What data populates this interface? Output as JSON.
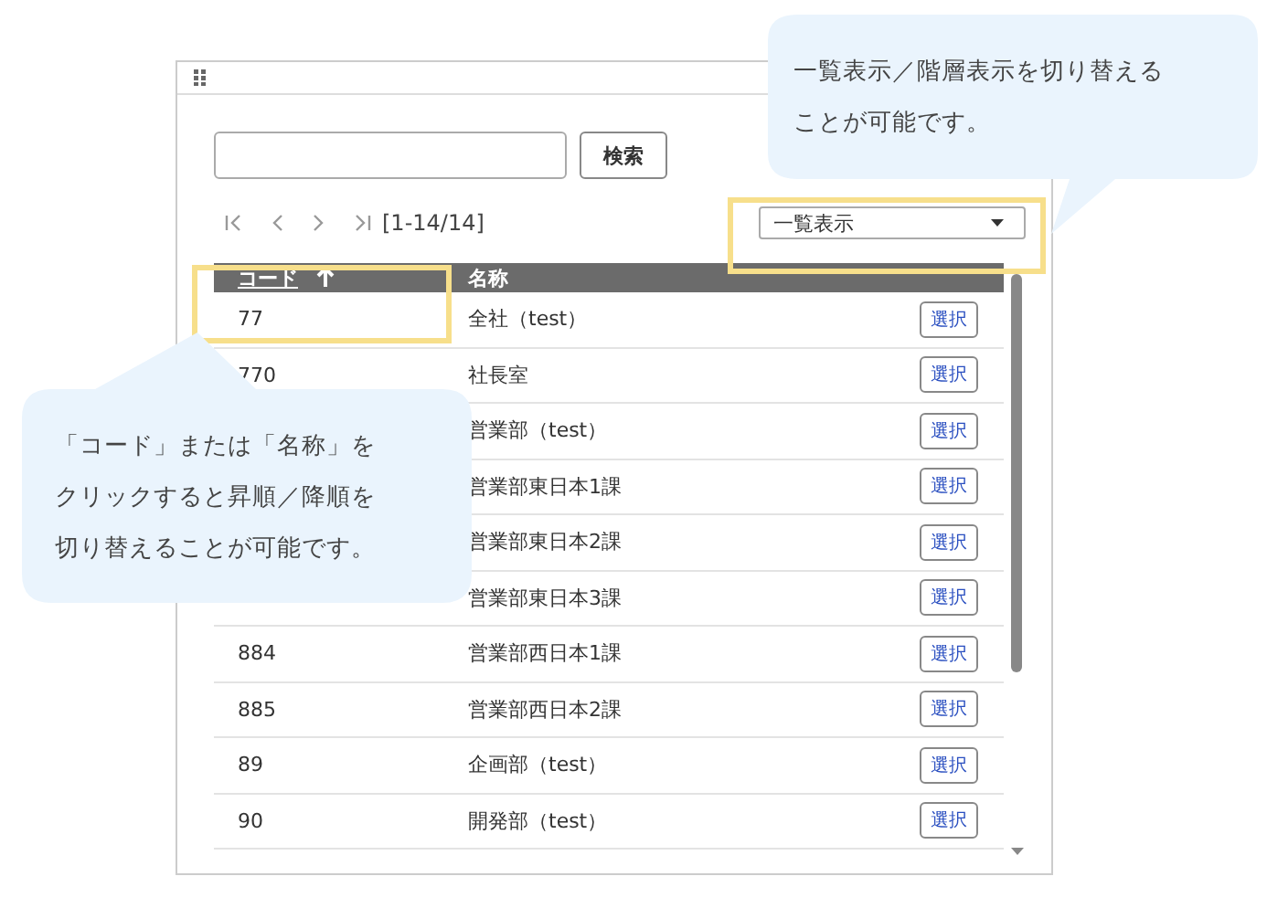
{
  "panel": {
    "search": {
      "button": "検索"
    },
    "pager": {
      "range": "[1-14/14]"
    },
    "view_select": {
      "value": "一覧表示"
    },
    "table": {
      "columns": [
        {
          "label": "コード",
          "ascending": true
        },
        {
          "label": "名称"
        }
      ],
      "rows": [
        {
          "code": "77",
          "name": "全社（test）",
          "action": "選択"
        },
        {
          "code": "770",
          "name": "社長室",
          "action": "選択"
        },
        {
          "name": "営業部（test）",
          "action": "選択"
        },
        {
          "name": "営業部東日本1課",
          "action": "選択"
        },
        {
          "name": "営業部東日本2課",
          "action": "選択"
        },
        {
          "name": "営業部東日本3課",
          "action": "選択"
        },
        {
          "code": "884",
          "name": "営業部西日本1課",
          "action": "選択"
        },
        {
          "code": "885",
          "name": "営業部西日本2課",
          "action": "選択"
        },
        {
          "code": "89",
          "name": "企画部（test）",
          "action": "選択"
        },
        {
          "code": "90",
          "name": "開発部（test）",
          "action": "選択"
        }
      ]
    }
  },
  "callouts": [
    {
      "lines": [
        "一覧表示／階層表示を切り替える",
        "ことが可能です。"
      ]
    },
    {
      "lines": [
        "「コード」または「名称」を",
        "クリックすると昇順／降順を",
        "切り替えることが可能です。"
      ]
    }
  ]
}
